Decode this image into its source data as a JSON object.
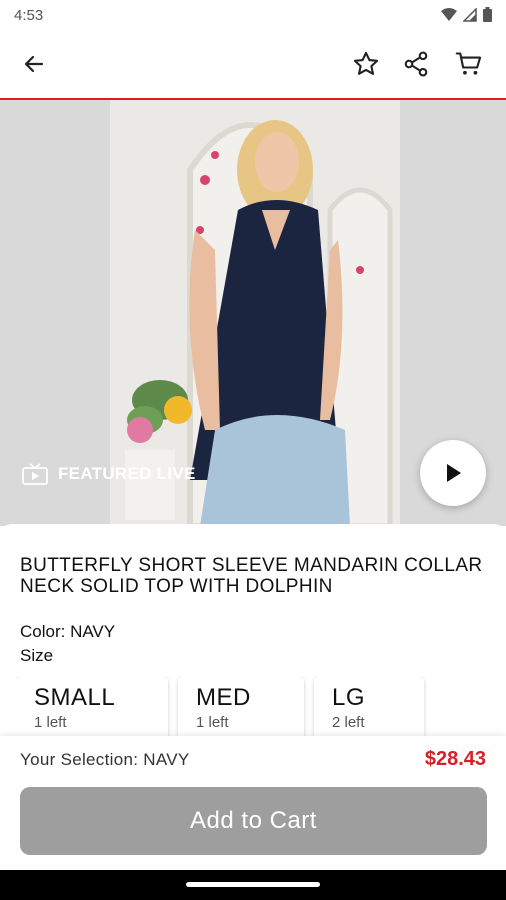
{
  "status_bar": {
    "time": "4:53"
  },
  "app_bar": {
    "back_icon": "arrow-left-icon",
    "actions": [
      "star-icon",
      "share-icon",
      "cart-icon"
    ]
  },
  "hero": {
    "featured_label": "FEATURED LIVE",
    "play_icon": "play-icon"
  },
  "product": {
    "title": "BUTTERFLY SHORT SLEEVE MANDARIN COLLAR NECK SOLID TOP WITH DOLPHIN",
    "color_label": "Color: NAVY",
    "size_label": "Size",
    "sizes": [
      {
        "name": "SMALL",
        "stock": "1 left"
      },
      {
        "name": "MED",
        "stock": "1 left"
      },
      {
        "name": "LG",
        "stock": "2 left"
      }
    ]
  },
  "footer": {
    "selection_text": "Your Selection: NAVY",
    "price": "$28.43",
    "add_to_cart_label": "Add to Cart"
  },
  "colors": {
    "accent": "#d61f26",
    "button_disabled": "#9e9e9e",
    "shirt": "#1c2540",
    "jeans": "#a9c3d8"
  }
}
